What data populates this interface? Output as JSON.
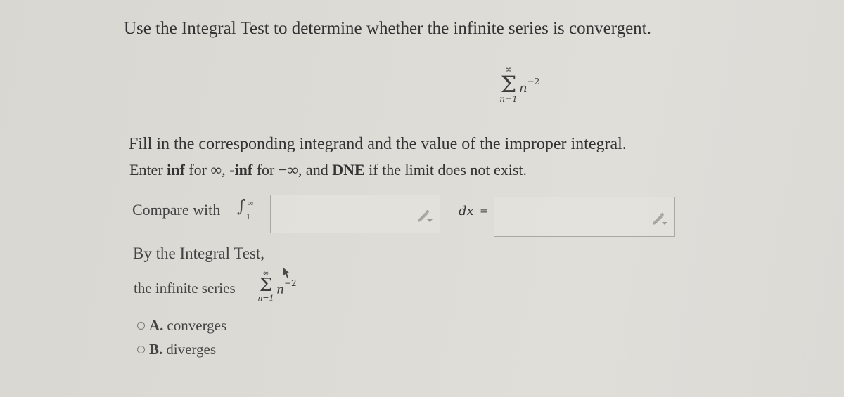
{
  "question": {
    "title": "Use the Integral Test to determine whether the infinite series is convergent.",
    "series": {
      "upper": "∞",
      "sigma": "Σ",
      "term_base": "n",
      "term_exponent": "−2",
      "lower": "n=1"
    }
  },
  "instructions": {
    "line1": "Fill in the corresponding integrand and the value of the improper integral.",
    "line2_prefix": "Enter ",
    "inf": "inf",
    "for_inf": " for ∞, ",
    "neg_inf": "-inf",
    "for_neg_inf": " for −∞, and ",
    "dne": "DNE",
    "line2_suffix": " if the limit does not exist."
  },
  "compare": {
    "label": "Compare with",
    "integral_sign": "∫",
    "upper": "∞",
    "lower": "1",
    "integrand_value": "",
    "dx_label": "dx",
    "equals": "=",
    "result_value": ""
  },
  "conclusion": {
    "by_label": "By the Integral Test,",
    "series_label": "the infinite series",
    "series": {
      "upper": "∞",
      "sigma": "Σ",
      "term_base": "n",
      "term_exponent": "−2",
      "lower": "n=1"
    },
    "options": [
      {
        "letter": "A.",
        "text": "converges",
        "selected": false
      },
      {
        "letter": "B.",
        "text": "diverges",
        "selected": false
      }
    ]
  },
  "icons": {
    "pencil": "pencil-dropdown-icon",
    "cursor": "mouse-cursor-icon"
  }
}
